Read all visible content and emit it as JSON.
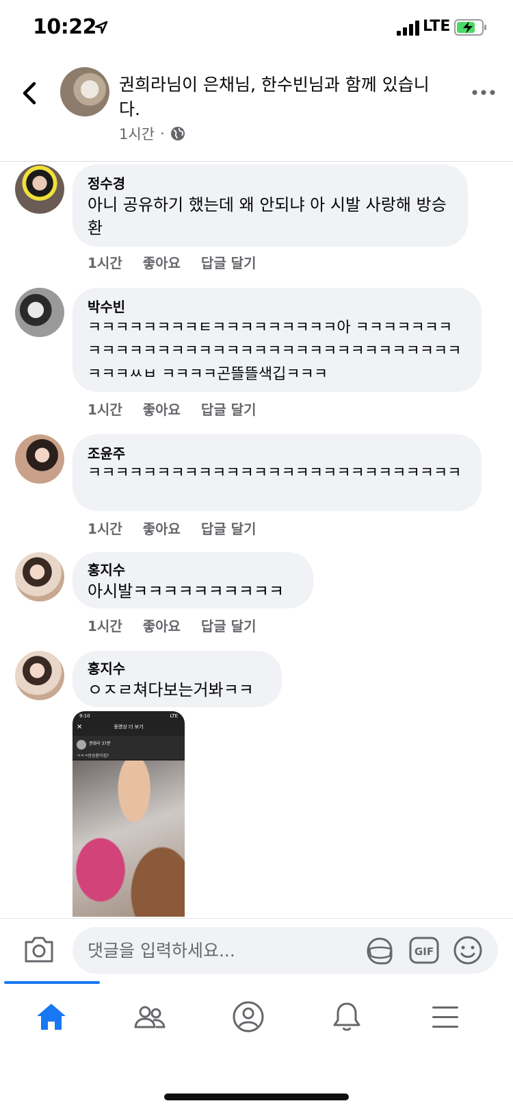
{
  "status_bar": {
    "time": "10:22",
    "network": "LTE"
  },
  "header": {
    "title": "권희라님이 은채님, 한수빈님과 함께 있습니다.",
    "time": "1시간",
    "separator": "·"
  },
  "comment_actions": {
    "like": "좋아요",
    "reply": "답글 달기"
  },
  "comments": [
    {
      "name": "정수경",
      "text": "아니 공유하기 했는데 왜 안되냐 아 시발 사랑해 방승환",
      "time": "1시간"
    },
    {
      "name": "박수빈",
      "text": "ㅋㅋㅋㅋㅋㅋㅋㅋㅌㅋㅋㅋㅋㅋㅋㅋㅋㅋ아 ㅋㅋㅋㅋㅋㅋㅋㅋㅋㅋㅋㅋㅋㅋㅋㅋㅋㅋㅋㅋㅋㅋㅋㅋㅋㅋㅋㅋㅋㅋㅋㅋㅋㅋㅋㅋㅋㅆㅂ ㅋㅋㅋㅋ곤뜰뜰색깁ㅋㅋㅋ",
      "time": "1시간"
    },
    {
      "name": "조윤주",
      "text": "ㅋㅋㅋㅋㅋㅋㅋㅋㅋㅋㅋㅋㅋㅋㅋㅋㅋㅋㅋㅋㅋㅋㅋㅋㅋㅋㅋ",
      "time": "1시간"
    },
    {
      "name": "홍지수",
      "text": "아시발ㅋㅋㅋㅋㅋㅋㅋㅋㅋㅋ",
      "time": "1시간"
    },
    {
      "name": "홍지수",
      "text": "ㅇㅈㄹ쳐다보는거봐ㅋㅋ"
    }
  ],
  "shared_video": {
    "time": "9:10",
    "network": "LTE",
    "close": "✕",
    "title": "동영상 더 보기",
    "author": "권희라",
    "meta": "37분",
    "caption": "ㅋㅋㅋ방승환이집?"
  },
  "composer": {
    "placeholder": "댓글을 입력하세요...",
    "gif_label": "GIF"
  },
  "icons": [
    "location-arrow-icon",
    "signal-icon",
    "battery-charging-icon",
    "back-icon",
    "globe-icon",
    "more-icon",
    "camera-icon",
    "sticker-icon",
    "gif-icon",
    "emoji-icon",
    "home-icon",
    "friends-icon",
    "profile-icon",
    "bell-icon",
    "menu-icon"
  ],
  "colors": {
    "accent": "#1877f2",
    "bubble": "#f0f2f5",
    "meta_text": "#65676b",
    "battery_charging": "#4cd964"
  }
}
